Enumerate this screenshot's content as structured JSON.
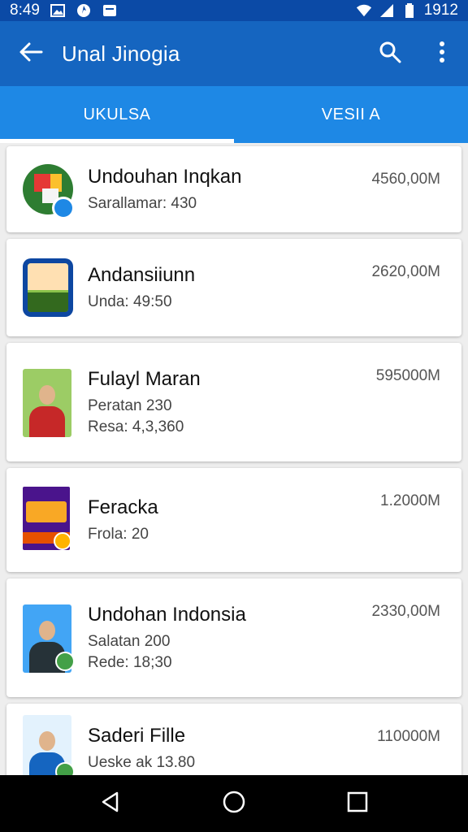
{
  "status_bar": {
    "time": "8:49",
    "battery": "1912",
    "icons": [
      "image-icon",
      "circle-app-icon",
      "message-icon",
      "wifi-icon",
      "signal-icon",
      "battery-icon"
    ]
  },
  "app_bar": {
    "title": "Unal Jinogia",
    "back_icon": "arrow-left-icon",
    "search_icon": "search-icon",
    "more_icon": "more-vert-icon"
  },
  "tabs": [
    {
      "label": "UKULSA",
      "active": true
    },
    {
      "label": "VESII A",
      "active": false
    }
  ],
  "items": [
    {
      "name": "Undouhan Inqkan",
      "lines": [
        "Sarallamar: 430"
      ],
      "size": "4560,00M",
      "thumb": "app-logo"
    },
    {
      "name": "Andansiiunn",
      "lines": [
        "Unda: 49:50"
      ],
      "size": "2620,00M",
      "thumb": "tablet"
    },
    {
      "name": "Fulayl Maran",
      "lines": [
        "Peratan 230",
        "Resa: 4,3,360"
      ],
      "size": "595000M",
      "thumb": "portrait-woman"
    },
    {
      "name": "Feracka",
      "lines": [
        "Frola: 20"
      ],
      "size": "1.2000M",
      "thumb": "poster"
    },
    {
      "name": "Undohan Indonsia",
      "lines": [
        "Salatan 200",
        "Rede: 18;30"
      ],
      "size": "2330,00M",
      "thumb": "portrait-man"
    },
    {
      "name": "Saderi Fille",
      "lines": [
        "Ueske ak 13.80"
      ],
      "size": "110000M",
      "thumb": "portrait-man2"
    }
  ],
  "nav_bar": {
    "icons": [
      "back-triangle-icon",
      "home-circle-icon",
      "recents-square-icon"
    ]
  },
  "colors": {
    "status_bar": "#0b4aa6",
    "app_bar": "#1565c0",
    "tabs": "#1e88e5",
    "indicator": "#ffffff"
  }
}
